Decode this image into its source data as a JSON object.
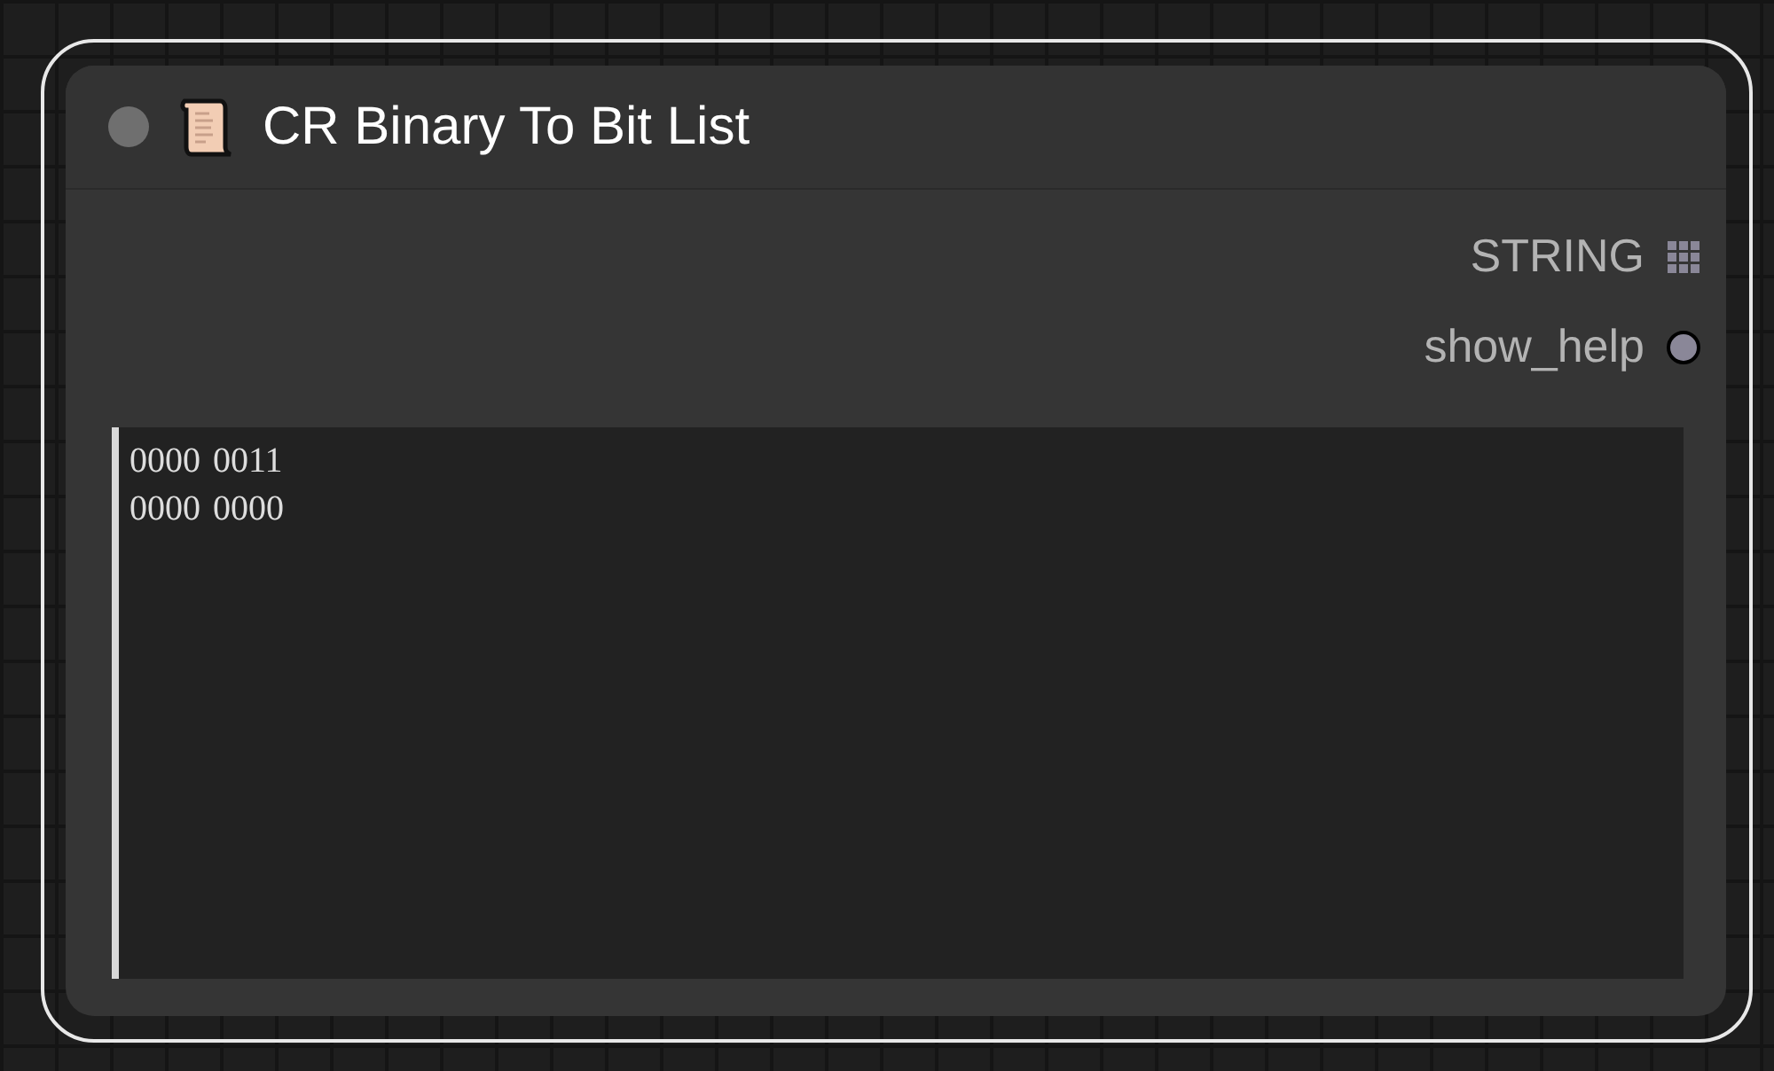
{
  "node": {
    "title": "CR Binary To Bit List",
    "collapsed": false,
    "outputs": [
      {
        "label": "STRING",
        "kind": "list"
      },
      {
        "label": "show_help",
        "kind": "single"
      }
    ],
    "text_widget": {
      "lines": [
        "0000 0011",
        "0000 0000"
      ]
    }
  }
}
